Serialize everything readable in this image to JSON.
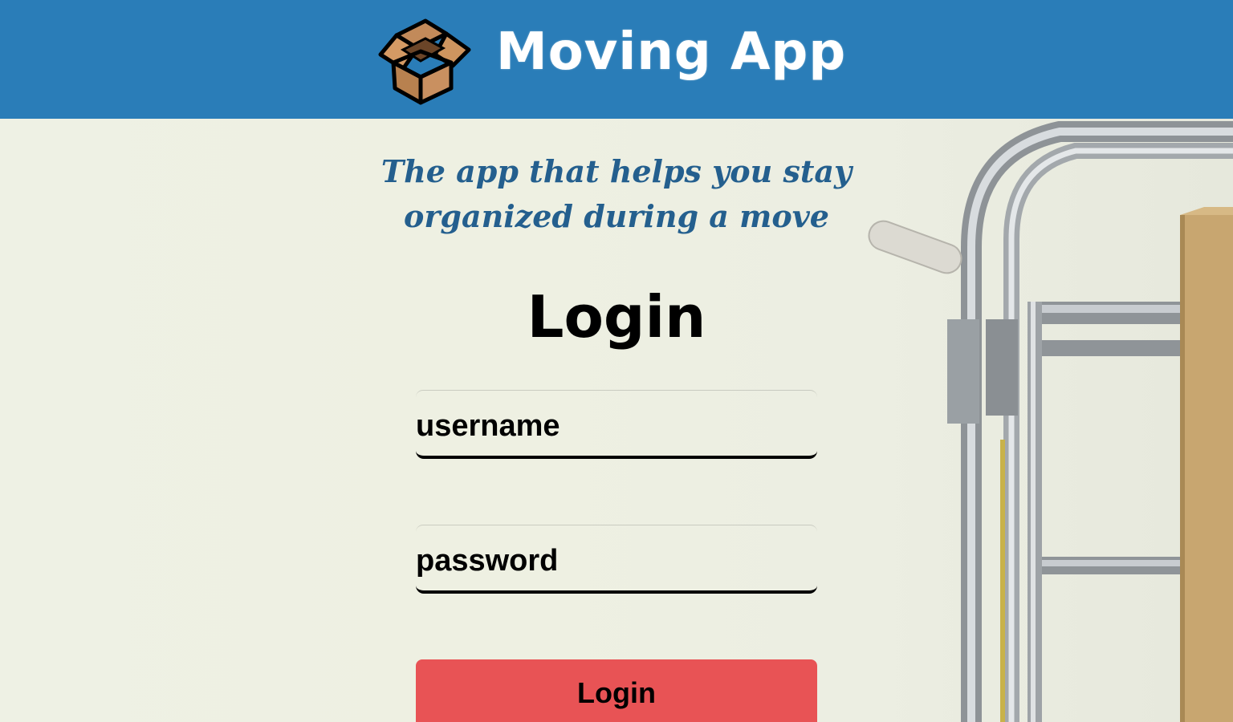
{
  "header": {
    "app_title": "Moving App",
    "logo_icon": "cardboard-box-icon",
    "background_color": "#2a7db8"
  },
  "main": {
    "tagline_line1": "The app that helps you stay",
    "tagline_line2": "organized during a move",
    "heading": "Login",
    "username": {
      "placeholder": "username",
      "value": ""
    },
    "password": {
      "placeholder": "password",
      "value": ""
    },
    "login_button_label": "Login",
    "login_button_color": "#e85355",
    "tagline_color": "#245f8e"
  },
  "background": {
    "image": "hand-truck-with-box"
  }
}
